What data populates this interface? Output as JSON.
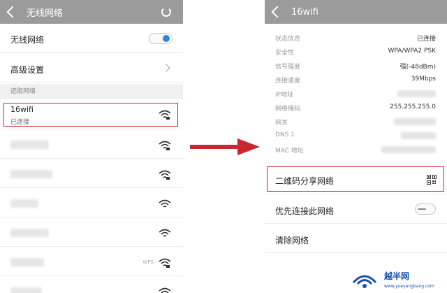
{
  "left": {
    "title": "无线网络",
    "wifi_toggle_label": "无线网络",
    "wifi_enabled": true,
    "advanced_label": "高级设置",
    "section_label": "选取网络",
    "connected_network": {
      "name": "16wifi",
      "status": "已连接"
    },
    "wps_label": "WPS"
  },
  "right": {
    "title": "16wifi",
    "info": [
      {
        "key": "状态信息",
        "value": "已连接"
      },
      {
        "key": "安全性",
        "value": "WPA/WPA2 PSK"
      },
      {
        "key": "信号强度",
        "value": "强(-48dBm)"
      },
      {
        "key": "连接速度",
        "value": "39Mbps"
      },
      {
        "key": "IP地址",
        "value": ""
      },
      {
        "key": "网络掩码",
        "value": "255.255.255.0"
      },
      {
        "key": "网关",
        "value": ""
      },
      {
        "key": "DNS 1",
        "value": ""
      },
      {
        "key": "MAC 地址",
        "value": ""
      }
    ],
    "qr_share_label": "二维码分享网络",
    "priority_label": "优先连接此网络",
    "priority_enabled": false,
    "forget_label": "清除网络"
  },
  "watermark": {
    "text": "越半网",
    "url": "www.yueyangbang.com"
  },
  "colors": {
    "titlebar": "#9b9b9b",
    "highlight": "#c0272d",
    "toggle_on": "#2d86d6",
    "arrow": "#c8272d",
    "watermark": "#1a4fb0"
  },
  "icons": {
    "back": "chevron-left-icon",
    "refresh": "refresh-icon",
    "chevron": "chevron-right-icon",
    "wifi": "wifi-signal-icon",
    "qr": "qr-code-icon",
    "arrow": "right-arrow-icon"
  }
}
